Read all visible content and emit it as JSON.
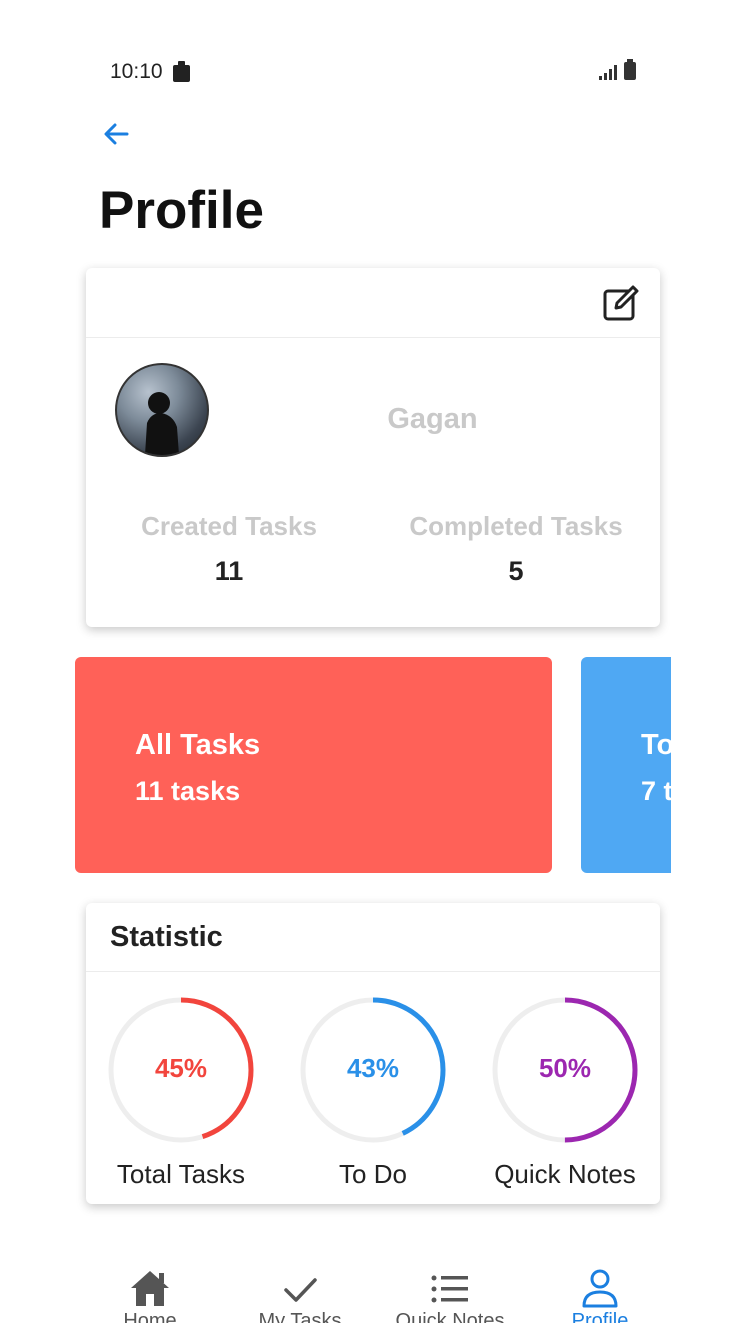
{
  "status_bar": {
    "time": "10:10"
  },
  "header": {
    "title": "Profile"
  },
  "profile": {
    "name": "Gagan",
    "stats": [
      {
        "label": "Created Tasks",
        "value": "11"
      },
      {
        "label": "Completed Tasks",
        "value": "5"
      }
    ]
  },
  "task_cards": [
    {
      "title": "All Tasks",
      "count": "11 tasks",
      "color": "#ff6158"
    },
    {
      "title": "To",
      "count": "7 t",
      "color": "#4fa8f3"
    }
  ],
  "statistic": {
    "title": "Statistic",
    "items": [
      {
        "label": "Total Tasks",
        "percent_text": "45%",
        "percent": 45,
        "color": "#f2453d"
      },
      {
        "label": "To Do",
        "percent_text": "43%",
        "percent": 43,
        "color": "#2a90e8"
      },
      {
        "label": "Quick Notes",
        "percent_text": "50%",
        "percent": 50,
        "color": "#9c27b0"
      }
    ]
  },
  "bottom_nav": {
    "active": "Profile",
    "items": [
      {
        "label": "Home",
        "icon": "home-icon"
      },
      {
        "label": "My Tasks",
        "icon": "check-icon"
      },
      {
        "label": "Quick Notes",
        "icon": "list-icon"
      },
      {
        "label": "Profile",
        "icon": "person-icon"
      }
    ]
  },
  "colors": {
    "accent": "#1b7fe0",
    "muted_text": "#c9c9c9"
  }
}
